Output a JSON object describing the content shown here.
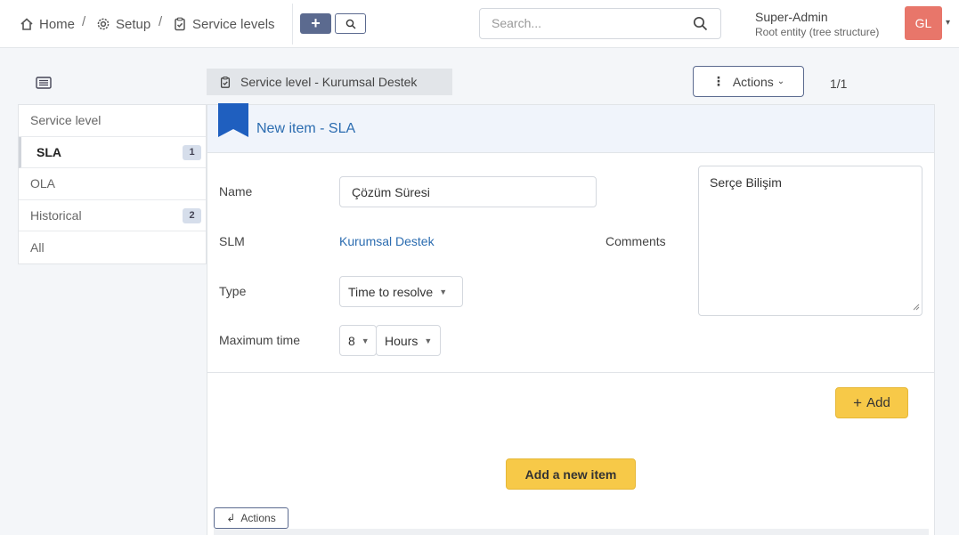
{
  "breadcrumb": {
    "home": "Home",
    "setup": "Setup",
    "service_levels": "Service levels",
    "separator": "/"
  },
  "header": {
    "add_icon_label": "+",
    "search_placeholder": "Search...",
    "user": {
      "name": "Super-Admin",
      "entity": "Root entity (tree structure)",
      "initials": "GL",
      "avatar_color": "#e8766a"
    }
  },
  "sidebar": {
    "items": [
      {
        "label": "Service level",
        "badge": ""
      },
      {
        "label": "SLA",
        "badge": "1"
      },
      {
        "label": "OLA",
        "badge": ""
      },
      {
        "label": "Historical",
        "badge": "2"
      },
      {
        "label": "All",
        "badge": ""
      }
    ],
    "active_index": 1
  },
  "page": {
    "title": "Service level - Kurumsal Destek",
    "actions_label": "Actions",
    "pager": "1/1"
  },
  "form": {
    "title": "New item - SLA",
    "name_label": "Name",
    "name_value": "Çözüm Süresi",
    "slm_label": "SLM",
    "slm_value": "Kurumsal Destek",
    "comments_label": "Comments",
    "comments_value": "Serçe Bilişim",
    "type_label": "Type",
    "type_value": "Time to resolve",
    "max_time_label": "Maximum time",
    "max_time_value": "8",
    "max_time_unit": "Hours",
    "add_label": "Add",
    "add_new_label": "Add a new item",
    "small_actions_label": "Actions"
  },
  "colors": {
    "accent": "#2b6cb0",
    "button_yellow": "#f7c948",
    "header_btn": "#5b6a8f"
  }
}
